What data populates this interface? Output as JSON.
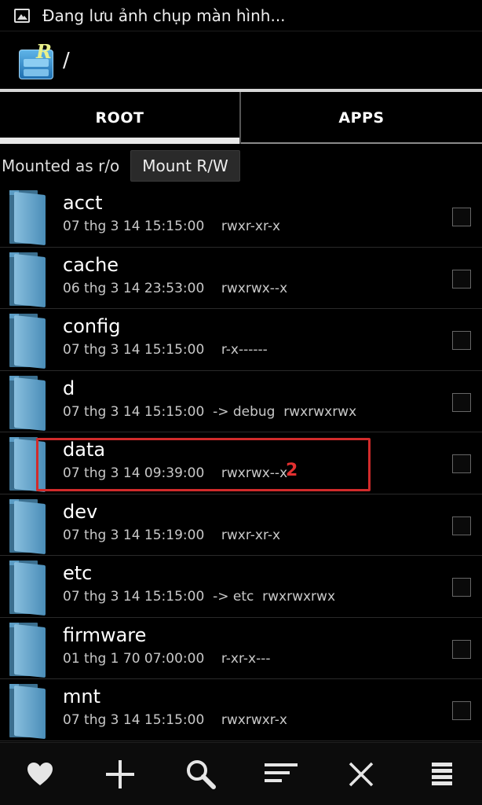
{
  "statusbar": {
    "notification_text": "Đang lưu ảnh chụp màn hình..."
  },
  "actionbar": {
    "path": "/"
  },
  "tabs": [
    {
      "label": "ROOT",
      "active": true
    },
    {
      "label": "APPS",
      "active": false
    }
  ],
  "mount": {
    "status": "Mounted as r/o",
    "button_label": "Mount R/W"
  },
  "files": [
    {
      "name": "acct",
      "meta": "07 thg 3 14 15:15:00    rwxr-xr-x"
    },
    {
      "name": "cache",
      "meta": "06 thg 3 14 23:53:00    rwxrwx--x"
    },
    {
      "name": "config",
      "meta": "07 thg 3 14 15:15:00    r-x------"
    },
    {
      "name": "d",
      "meta": "07 thg 3 14 15:15:00  -> debug  rwxrwxrwx"
    },
    {
      "name": "data",
      "meta": "07 thg 3 14 09:39:00    rwxrwx--x"
    },
    {
      "name": "dev",
      "meta": "07 thg 3 14 15:19:00    rwxr-xr-x"
    },
    {
      "name": "etc",
      "meta": "07 thg 3 14 15:15:00  -> etc  rwxrwxrwx"
    },
    {
      "name": "firmware",
      "meta": "01 thg 1 70 07:00:00    r-xr-x---"
    },
    {
      "name": "mnt",
      "meta": "07 thg 3 14 15:15:00    rwxrwxr-x"
    }
  ],
  "annotation": {
    "label": "2",
    "color": "#d12b2b"
  },
  "bottom_actions": [
    "heart-icon",
    "plus-icon",
    "search-icon",
    "sort-icon",
    "close-icon",
    "menu-icon"
  ]
}
